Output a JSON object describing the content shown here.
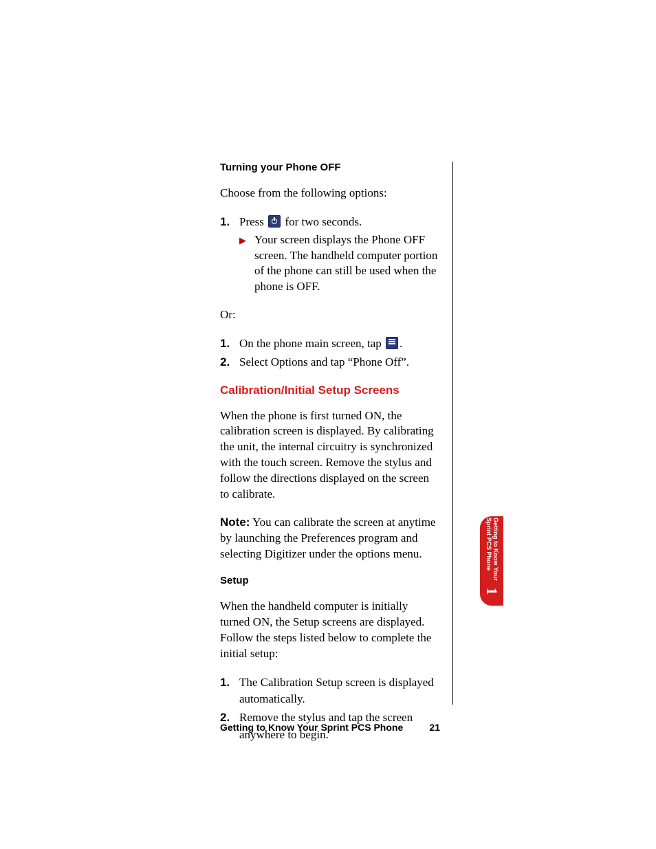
{
  "headings": {
    "turn_off": "Turning your Phone OFF",
    "calibration": "Calibration/Initial Setup Screens",
    "setup": "Setup"
  },
  "intro": {
    "choose": "Choose from the following options:",
    "or": "Or:"
  },
  "list1": {
    "n1": "1.",
    "i1a": "Press ",
    "i1b": " for two seconds.",
    "b1": "Your screen displays the Phone OFF screen. The handheld computer portion of the phone can still be used when the phone is OFF."
  },
  "list2": {
    "n1": "1.",
    "i1a": "On the phone main screen, tap ",
    "i1b": ".",
    "n2": "2.",
    "i2": "Select Options and tap “Phone Off”."
  },
  "para": {
    "calib": "When the phone is first turned ON, the calibration screen is displayed. By calibrating the unit, the internal circuitry is synchronized with the touch screen. Remove the stylus and follow the directions displayed on the screen to calibrate.",
    "note_label": "Note:",
    "note_body": "  You can calibrate the screen at anytime by launching the Preferences program and selecting Digitizer under the options menu.",
    "setup": "When the handheld computer is initially turned ON, the Setup screens are displayed. Follow the steps listed below to complete the initial setup:"
  },
  "list3": {
    "n1": "1.",
    "i1": "The Calibration Setup screen is displayed automatically.",
    "n2": "2.",
    "i2": "Remove the stylus and tap the screen anywhere to begin."
  },
  "tab": {
    "line1": "Getting to Know Your",
    "line2": "Sprint PCS Phone",
    "num": "1"
  },
  "footer": {
    "title": "Getting to Know Your Sprint PCS Phone",
    "page": "21"
  }
}
